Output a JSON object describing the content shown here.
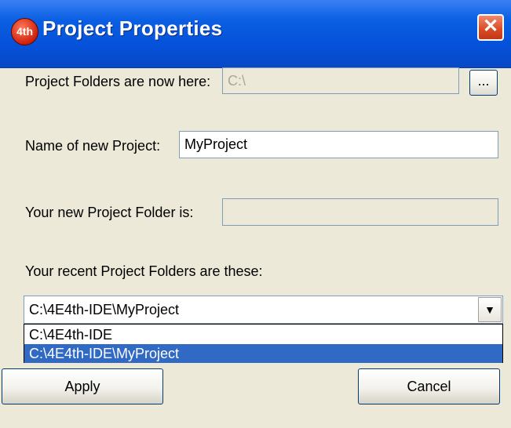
{
  "window": {
    "title": "Project Properties",
    "app_icon_text": "4th",
    "close_glyph": "✕"
  },
  "project_folders": {
    "label": "Project Folders are now here:",
    "value": "C:\\",
    "browse_label": "..."
  },
  "new_project_name": {
    "label": "Name of new Project:",
    "value": "MyProject"
  },
  "new_project_folder": {
    "label": "Your new Project Folder is:",
    "value": ""
  },
  "recent_folders": {
    "label": "Your recent Project Folders are these:",
    "selected_value": "C:\\4E4th-IDE\\MyProject",
    "arrow_glyph": "▼",
    "options": [
      "C:\\4E4th-IDE",
      "C:\\4E4th-IDE\\MyProject"
    ],
    "highlighted_index": 1
  },
  "buttons": {
    "apply_label": "Apply",
    "cancel_label": "Cancel"
  },
  "colors": {
    "title_bar": "#0550d8",
    "dialog_bg": "#ece9d8",
    "selection": "#316ac5",
    "close_button": "#d84a24"
  }
}
